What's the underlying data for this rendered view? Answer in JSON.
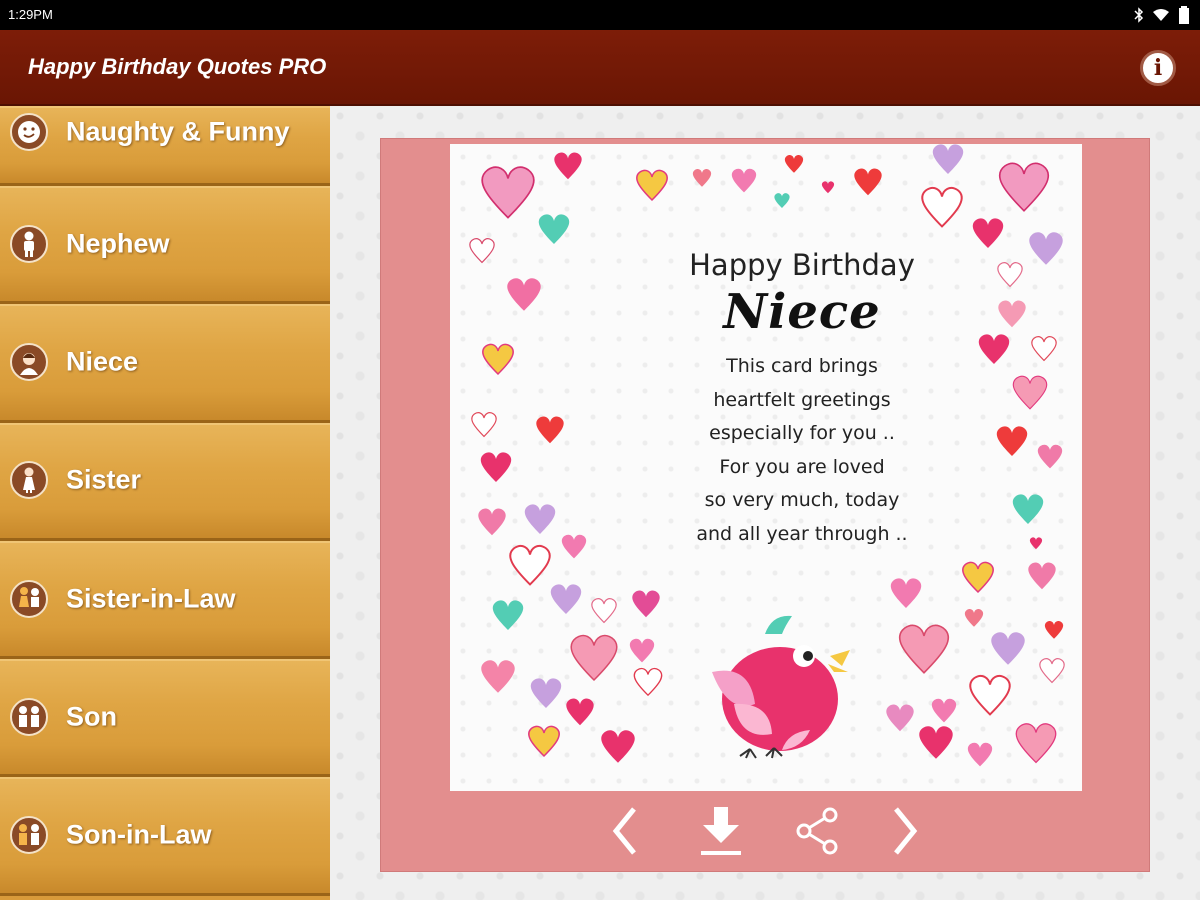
{
  "status_bar": {
    "time": "1:29PM"
  },
  "app_bar": {
    "title": "Happy Birthday Quotes PRO",
    "info_icon": "info-icon"
  },
  "sidebar": {
    "items": [
      {
        "label": "Naughty & Funny",
        "icon": "smiley-icon"
      },
      {
        "label": "Nephew",
        "icon": "boy-icon"
      },
      {
        "label": "Niece",
        "icon": "girl-icon"
      },
      {
        "label": "Sister",
        "icon": "sister-icon"
      },
      {
        "label": "Sister-in-Law",
        "icon": "sister-in-law-icon"
      },
      {
        "label": "Son",
        "icon": "son-icon"
      },
      {
        "label": "Son-in-Law",
        "icon": "son-in-law-icon"
      }
    ]
  },
  "card": {
    "title": "Happy Birthday",
    "name": "Niece",
    "lines": [
      "This card brings",
      "heartfelt greetings",
      "especially for you ..",
      "For you are loved",
      "so very much, today",
      "and all year through .."
    ]
  },
  "controls": {
    "previous": "chevron-left-icon",
    "download": "download-icon",
    "share": "share-icon",
    "next": "chevron-right-icon"
  },
  "colors": {
    "app_bar": "#7d1d08",
    "sidebar": "#dfa544",
    "card_frame": "#e38e8e"
  }
}
